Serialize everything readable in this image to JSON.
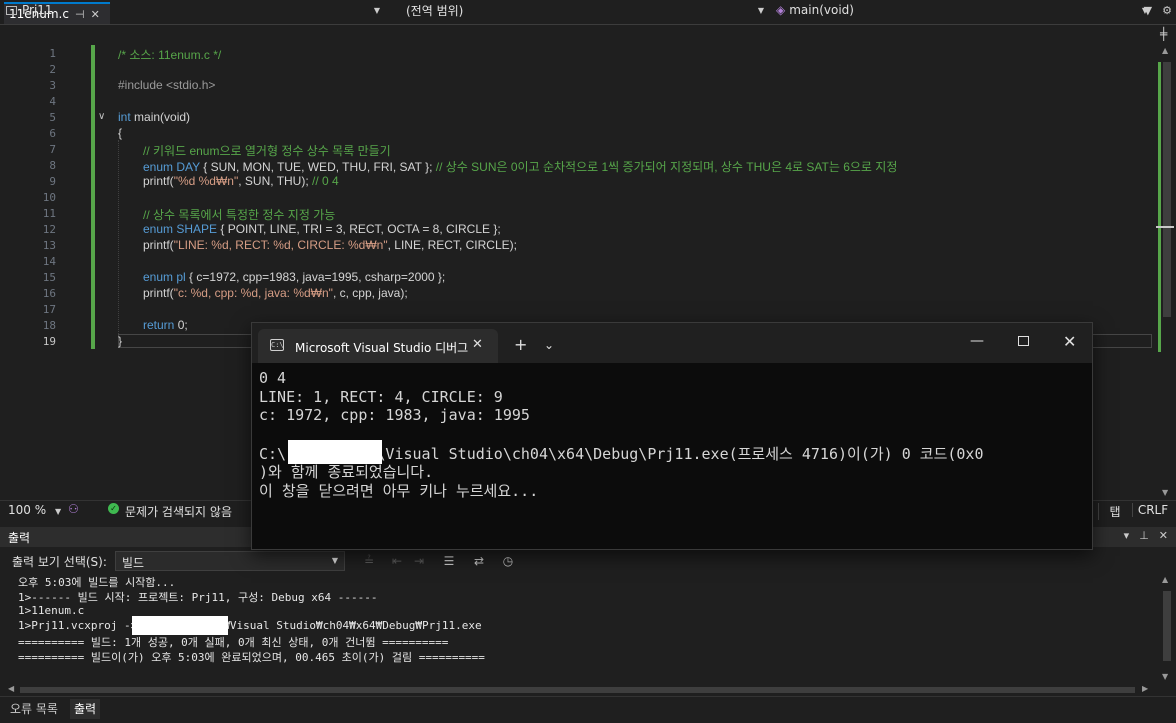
{
  "tabstrip": {
    "file_tab": "11enum.c",
    "pin_icon": "pin-icon",
    "close_icon": "close-icon"
  },
  "navbar": {
    "project": "Prj11",
    "scope": "(전역 범위)",
    "member": "main(void)"
  },
  "editor": {
    "line_numbers": [
      "1",
      "2",
      "3",
      "4",
      "5",
      "6",
      "7",
      "8",
      "9",
      "10",
      "11",
      "12",
      "13",
      "14",
      "15",
      "16",
      "17",
      "18",
      "19"
    ],
    "current_line": "19",
    "lines": [
      "/* 소스: 11enum.c */",
      "",
      "#include <stdio.h>",
      "",
      "int main(void)",
      "{",
      "    // 키워드 enum으로 열거형 정수 상수 목록 만들기",
      "    enum DAY { SUN, MON, TUE, WED, THU, FRI, SAT }; // 상수 SUN은 0이고 순차적으로 1씩 증가되어 지정되며, 상수 THU은 4로 SAT는 6으로 지정",
      "    printf(\"%d %d\\n\", SUN, THU); // 0 4",
      "",
      "    // 상수 목록에서 특정한 정수 지정 가능",
      "    enum SHAPE { POINT, LINE, TRI = 3, RECT, OCTA = 8, CIRCLE };",
      "    printf(\"LINE: %d, RECT: %d, CIRCLE: %d\\n\", LINE, RECT, CIRCLE);",
      "",
      "    enum pl { c=1972, cpp=1983, java=1995, csharp=2000 };",
      "    printf(\"c: %d, cpp: %d, java: %d\\n\", c, cpp, java);",
      "",
      "    return 0;",
      "}"
    ],
    "seg": {
      "l1": "/* 소스: 11enum.c */",
      "l3": "#include <stdio.h>",
      "l5_kw": "int",
      "l5_rest": " main(void)",
      "l6": "{",
      "l7": "// 키워드 enum으로 열거형 정수 상수 목록 만들기",
      "l8_kw": "enum",
      "l8_type": " DAY",
      "l8_body": " { SUN, MON, TUE, WED, THU, FRI, SAT };",
      "l8_cmt": " // 상수 SUN은 0이고 순차적으로 1씩 증가되어 지정되며, 상수 THU은 4로 SAT는 6으로 지정",
      "l9_fn": "printf(",
      "l9_str": "\"%d %d₩n\"",
      "l9_rest": ", SUN, THU);",
      "l9_cmt": " // 0 4",
      "l11": "// 상수 목록에서 특정한 정수 지정 가능",
      "l12_kw": "enum",
      "l12_type": " SHAPE",
      "l12_body": " { POINT, LINE, TRI = 3, RECT, OCTA = 8, CIRCLE };",
      "l13_fn": "printf(",
      "l13_str": "\"LINE: %d, RECT: %d, CIRCLE: %d₩n\"",
      "l13_rest": ", LINE, RECT, CIRCLE);",
      "l15_kw": "enum",
      "l15_type": " pl",
      "l15_body": " { c=1972, cpp=1983, java=1995, csharp=2000 };",
      "l16_fn": "printf(",
      "l16_str": "\"c: %d, cpp: %d, java: %d₩n\"",
      "l16_rest": ", c, cpp, java);",
      "l18_kw": "return",
      "l18_rest": " 0;",
      "l19": "}"
    }
  },
  "status": {
    "zoom": "100 %",
    "issues": "문제가 검색되지 않음",
    "indent": "탭",
    "line_ending": "CRLF"
  },
  "output": {
    "title": "출력",
    "show_from_label": "출력 보기 선택(S):",
    "show_from_value": "빌드",
    "lines": [
      "오후 5:03에 빌드를 시작함...",
      "1>------ 빌드 시작: 프로젝트: Prj11, 구성: Debug x64 ------",
      "1>11enum.c",
      "1>Prj11.vcxproj ->             ₩Visual Studio₩ch04₩x64₩Debug₩Prj11.exe",
      "========== 빌드: 1개 성공, 0개 실패, 0개 최신 상태, 0개 건너뜀 ==========",
      "========== 빌드이(가) 오후 5:03에 완료되었으며, 00.465 초이(가) 걸림 =========="
    ]
  },
  "bottom_tabs": [
    "오류 목록",
    "출력"
  ],
  "console": {
    "tab_title": "Microsoft Visual Studio 디버그",
    "tab_icon_text": "C:\\",
    "lines": [
      "0 4",
      "LINE: 1, RECT: 4, CIRCLE: 9",
      "c: 1972, cpp: 1983, java: 1995",
      "",
      "C:\\          \\Visual Studio\\ch04\\x64\\Debug\\Prj11.exe(프로세스 4716)이(가) 0 코드(0x0",
      ")와 함께 종료되었습니다.",
      "이 창을 닫으려면 아무 키나 누르세요..."
    ]
  },
  "colors": {
    "accent": "#007acc",
    "change_bar": "#57a64a",
    "comment": "#57a64a",
    "keyword": "#569cd6",
    "string": "#d69d85"
  }
}
